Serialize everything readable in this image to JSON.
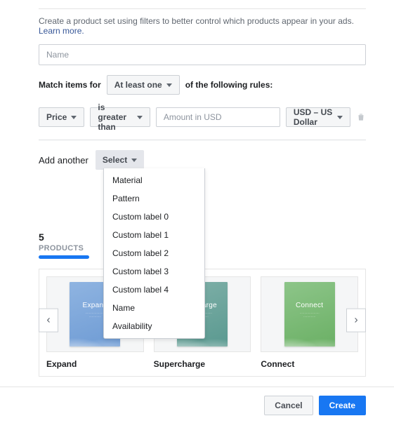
{
  "intro": {
    "text": "Create a product set using filters to better control which products appear in your ads. ",
    "link": "Learn more."
  },
  "name_input": {
    "placeholder": "Name"
  },
  "match": {
    "prefix": "Match items for",
    "mode": "At least one",
    "suffix": "of the following rules:"
  },
  "rule": {
    "field": "Price",
    "operator": "is greater than",
    "amount_placeholder": "Amount in USD",
    "currency": "USD – US Dollar"
  },
  "add_another": {
    "label": "Add another",
    "select": "Select",
    "options": [
      "Material",
      "Pattern",
      "Custom label 0",
      "Custom label 1",
      "Custom label 2",
      "Custom label 3",
      "Custom label 4",
      "Name",
      "Availability"
    ]
  },
  "products": {
    "count": "5",
    "label": "PRODUCTS",
    "items": [
      {
        "title": "Expand",
        "cover_word": "Expand",
        "brand": ""
      },
      {
        "title": "Supercharge",
        "cover_word": "ercharge",
        "brand": ""
      },
      {
        "title": "Connect",
        "cover_word": "Connect",
        "brand": ""
      }
    ]
  },
  "footer": {
    "cancel": "Cancel",
    "create": "Create"
  }
}
